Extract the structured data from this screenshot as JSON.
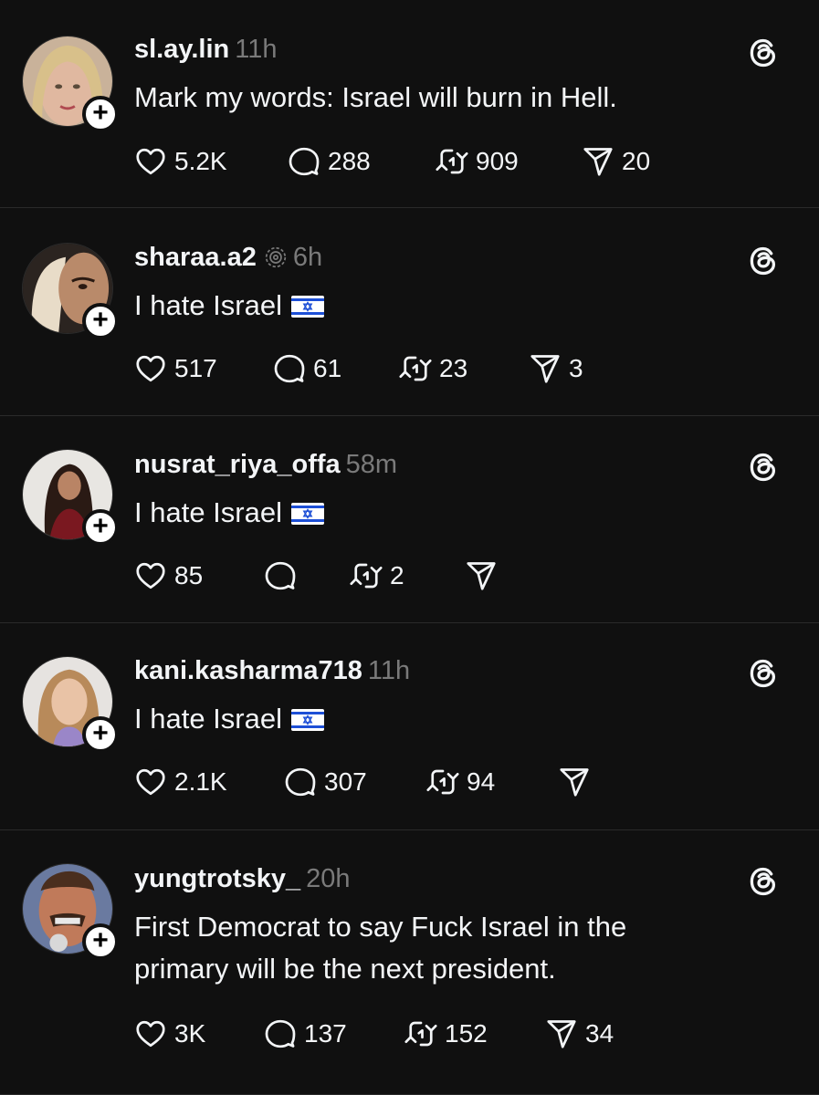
{
  "posts": [
    {
      "username": "sl.ay.lin",
      "time": "11h",
      "verified": false,
      "text": "Mark my words: Israel will burn in Hell.",
      "flag": false,
      "likes": "5.2K",
      "replies": "288",
      "reposts": "909",
      "shares": "20"
    },
    {
      "username": "sharaa.a2",
      "time": "6h",
      "verified": true,
      "text": "I hate Israel",
      "flag": true,
      "likes": "517",
      "replies": "61",
      "reposts": "23",
      "shares": "3"
    },
    {
      "username": "nusrat_riya_offa",
      "time": "58m",
      "verified": false,
      "text": "I hate Israel",
      "flag": true,
      "likes": "85",
      "replies": "",
      "reposts": "2",
      "shares": ""
    },
    {
      "username": "kani.kasharma718",
      "time": "11h",
      "verified": false,
      "text": "I hate Israel",
      "flag": true,
      "likes": "2.1K",
      "replies": "307",
      "reposts": "94",
      "shares": ""
    },
    {
      "username": "yungtrotsky_",
      "time": "20h",
      "verified": false,
      "text": "First Democrat to say Fuck Israel in the primary will be the next president.",
      "flag": false,
      "likes": "3K",
      "replies": "137",
      "reposts": "152",
      "shares": "34"
    }
  ],
  "icons": {
    "like": "heart-icon",
    "reply": "speech-bubble-icon",
    "repost": "repost-arrows-icon",
    "share": "paper-plane-icon",
    "brand": "threads-logo-icon",
    "follow": "plus-icon",
    "flag": "israel-flag-icon"
  },
  "colors": {
    "background": "#101010",
    "text": "#f3f5f7",
    "muted": "#7a7a7a",
    "divider": "#2a2a2a"
  }
}
